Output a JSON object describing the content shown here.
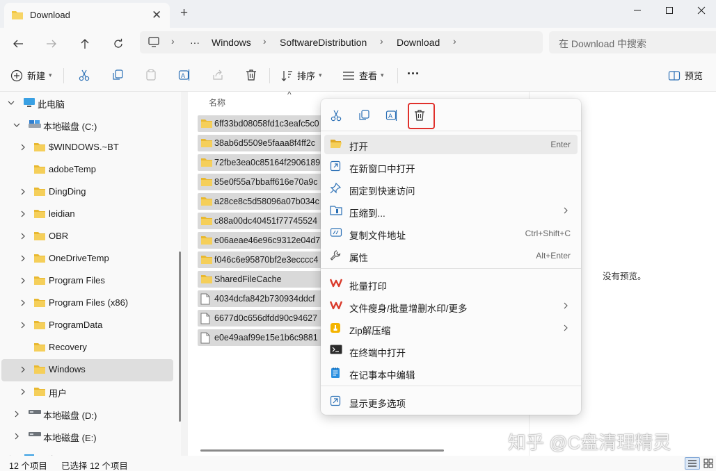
{
  "window": {
    "tab_title": "Download",
    "tab_close": "✕",
    "new_tab": "+"
  },
  "address": {
    "more": "···",
    "crumbs": [
      "Windows",
      "SoftwareDistribution",
      "Download"
    ],
    "search_placeholder": "在 Download 中搜索"
  },
  "toolbar": {
    "new_label": "新建",
    "sort_label": "排序",
    "view_label": "查看",
    "more_label": "···",
    "preview_label": "预览"
  },
  "nav": {
    "items": [
      {
        "label": "此电脑",
        "type": "pc"
      },
      {
        "label": "本地磁盘 (C:)",
        "type": "drive"
      },
      {
        "label": "$WINDOWS.~BT",
        "type": "folder"
      },
      {
        "label": "adobeTemp",
        "type": "folder"
      },
      {
        "label": "DingDing",
        "type": "folder"
      },
      {
        "label": "leidian",
        "type": "folder"
      },
      {
        "label": "OBR",
        "type": "folder"
      },
      {
        "label": "OneDriveTemp",
        "type": "folder"
      },
      {
        "label": "Program Files",
        "type": "folder"
      },
      {
        "label": "Program Files (x86)",
        "type": "folder"
      },
      {
        "label": "ProgramData",
        "type": "folder"
      },
      {
        "label": "Recovery",
        "type": "folder"
      },
      {
        "label": "Windows",
        "type": "folder"
      },
      {
        "label": "用户",
        "type": "folder"
      },
      {
        "label": "本地磁盘 (D:)",
        "type": "disk"
      },
      {
        "label": "本地磁盘 (E:)",
        "type": "disk"
      },
      {
        "label": "网络",
        "type": "network"
      }
    ]
  },
  "files": {
    "column_name": "名称",
    "rows": [
      {
        "name": "6ff33bd08058fd1c3eafc5c0",
        "type": "folder"
      },
      {
        "name": "38ab6d5509e5faaa8f4ff2c",
        "type": "folder"
      },
      {
        "name": "72fbe3ea0c85164f2906189",
        "type": "folder"
      },
      {
        "name": "85e0f55a7bbaff616e70a9c",
        "type": "folder"
      },
      {
        "name": "a28ce8c5d58096a07b034c",
        "type": "folder"
      },
      {
        "name": "c88a00dc40451f77745524",
        "type": "folder"
      },
      {
        "name": "e06aeae46e96c9312e04d7",
        "type": "folder"
      },
      {
        "name": "f046c6e95870bf2e3ecccc4",
        "type": "folder"
      },
      {
        "name": "SharedFileCache",
        "type": "folder"
      },
      {
        "name": "4034dcfa842b730934ddcf",
        "type": "file"
      },
      {
        "name": "6677d0c656dfdd90c94627",
        "type": "file"
      },
      {
        "name": "e0e49aaf99e15e1b6c9881",
        "type": "file"
      }
    ]
  },
  "preview": {
    "empty_text": "没有预览。"
  },
  "context_menu": {
    "items": [
      {
        "label": "打开",
        "shortcut": "Enter",
        "icon": "folder-open-icon"
      },
      {
        "label": "在新窗口中打开",
        "shortcut": "",
        "icon": "new-window-icon"
      },
      {
        "label": "固定到快速访问",
        "shortcut": "",
        "icon": "pin-icon"
      },
      {
        "label": "压缩到...",
        "shortcut": "",
        "icon": "zip-icon",
        "submenu": true
      },
      {
        "label": "复制文件地址",
        "shortcut": "Ctrl+Shift+C",
        "icon": "copy-path-icon"
      },
      {
        "label": "属性",
        "shortcut": "Alt+Enter",
        "icon": "wrench-icon"
      },
      {
        "label": "批量打印",
        "shortcut": "",
        "icon": "wps-icon"
      },
      {
        "label": "文件瘦身/批量增删水印/更多",
        "shortcut": "",
        "icon": "wps-icon",
        "submenu": true
      },
      {
        "label": "Zip解压缩",
        "shortcut": "",
        "icon": "zip-extract-icon",
        "submenu": true
      },
      {
        "label": "在终端中打开",
        "shortcut": "",
        "icon": "terminal-icon"
      },
      {
        "label": "在记事本中编辑",
        "shortcut": "",
        "icon": "notepad-icon"
      },
      {
        "label": "显示更多选项",
        "shortcut": "",
        "icon": "more-options-icon"
      }
    ]
  },
  "status": {
    "item_count": "12 个项目",
    "selected_count": "已选择 12 个项目"
  },
  "watermark": "知乎 @C盘清理精灵",
  "colors": {
    "folder": "#f2c744",
    "highlight_border": "#e0302b",
    "wps_red": "#d93a2b"
  }
}
